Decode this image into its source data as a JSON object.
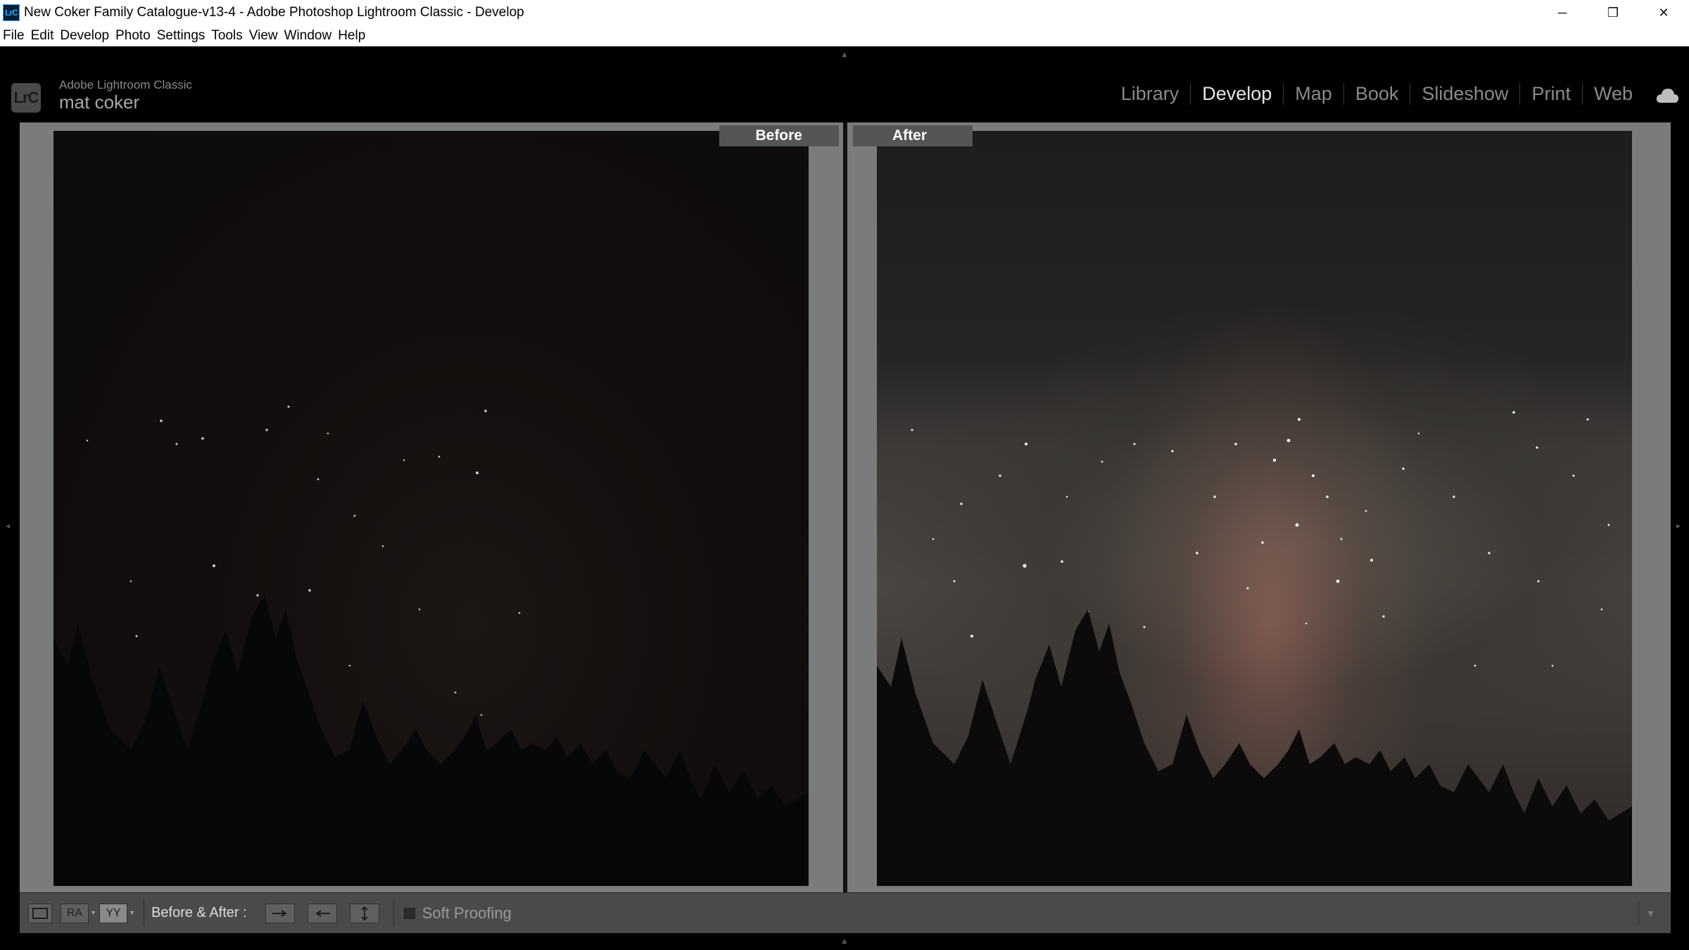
{
  "window": {
    "app_icon_text": "LrC",
    "title": "New Coker Family Catalogue-v13-4 - Adobe Photoshop Lightroom Classic - Develop",
    "minimize": "─",
    "restore": "❐",
    "close": "✕"
  },
  "menu": [
    "File",
    "Edit",
    "Develop",
    "Photo",
    "Settings",
    "Tools",
    "View",
    "Window",
    "Help"
  ],
  "identity": {
    "logo": "LrC",
    "app_label": "Adobe Lightroom Classic",
    "user": "mat coker"
  },
  "modules": [
    "Library",
    "Develop",
    "Map",
    "Book",
    "Slideshow",
    "Print",
    "Web"
  ],
  "active_module": "Develop",
  "icons": {
    "cloud": "cloud-icon",
    "view_loupe": "loupe-view-icon",
    "view_ra": "before-after-left-right-icon",
    "view_yy": "before-after-split-icon",
    "swap_settings": "copy-before-to-after-icon",
    "copy_after": "copy-after-to-before-icon",
    "swap": "swap-before-after-icon"
  },
  "view": {
    "before_label": "Before",
    "after_label": "After"
  },
  "toolbar": {
    "ra_label": "RA",
    "yy_label": "YY",
    "before_after_label": "Before & After :",
    "soft_proofing_label": "Soft Proofing",
    "soft_proofing_checked": false
  },
  "colors": {
    "active_module": "#e6e6e6",
    "inactive_module": "#8a8a8a",
    "panel_gray": "#777777",
    "toolbar": "#4a4a4a"
  }
}
